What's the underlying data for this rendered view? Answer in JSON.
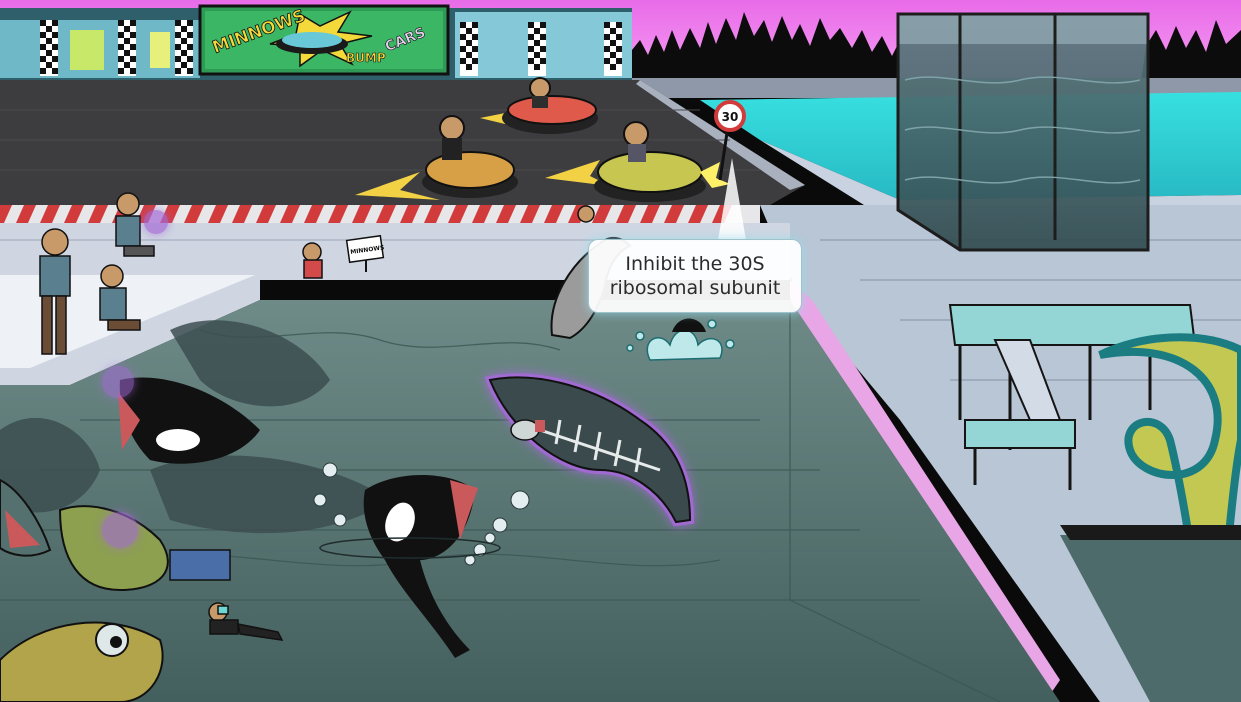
{
  "scene": {
    "banner": {
      "line1": "MINNOWS",
      "line2": "BUMP",
      "line3": "CARS"
    },
    "speed_sign": "30",
    "small_sign": "MINNOWS",
    "tooltip": {
      "line1": "Inhibit the 30S",
      "line2": "ribosomal subunit"
    }
  },
  "colors": {
    "sky": "#f07ff0",
    "track": "#3d3d3f",
    "pool_water": "#5b7775",
    "deck": "#b9c6d6",
    "teal": "#3fd6d6",
    "tank_glass": "#3f5c60",
    "highlight_glow": "#a56bd8"
  }
}
